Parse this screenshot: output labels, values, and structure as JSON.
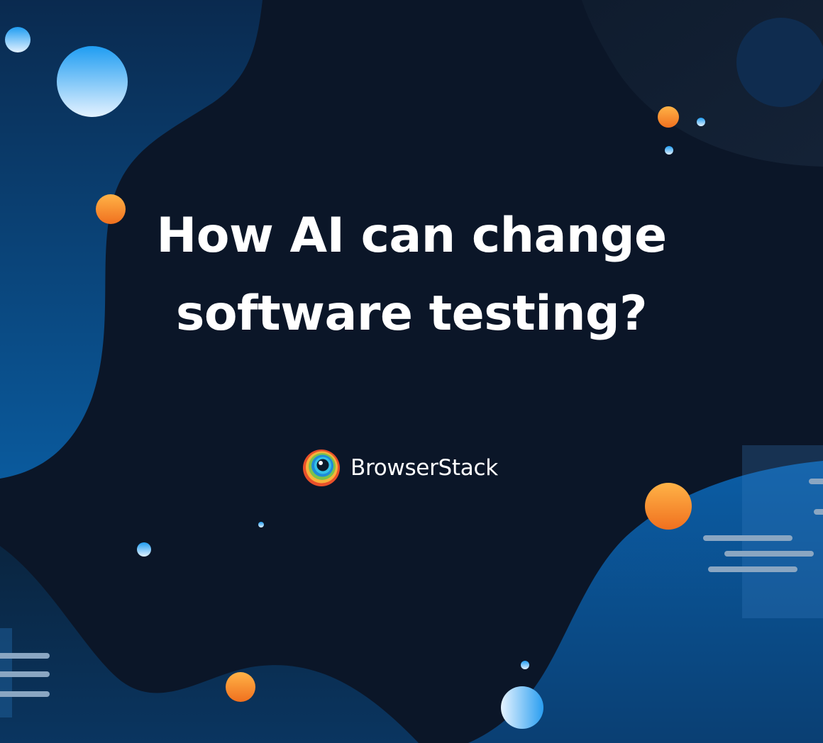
{
  "banner": {
    "headline_line1": "How AI can change",
    "headline_line2": "software testing?"
  },
  "brand": {
    "name": "BrowserStack",
    "logo_icon": "browserstack-eye-logo-icon"
  },
  "colors": {
    "background": "#0b1628",
    "blob_blue": "#0a5597",
    "accent_orange": "#f58a25",
    "accent_light_blue": "#5ab9f5",
    "text": "#ffffff"
  }
}
